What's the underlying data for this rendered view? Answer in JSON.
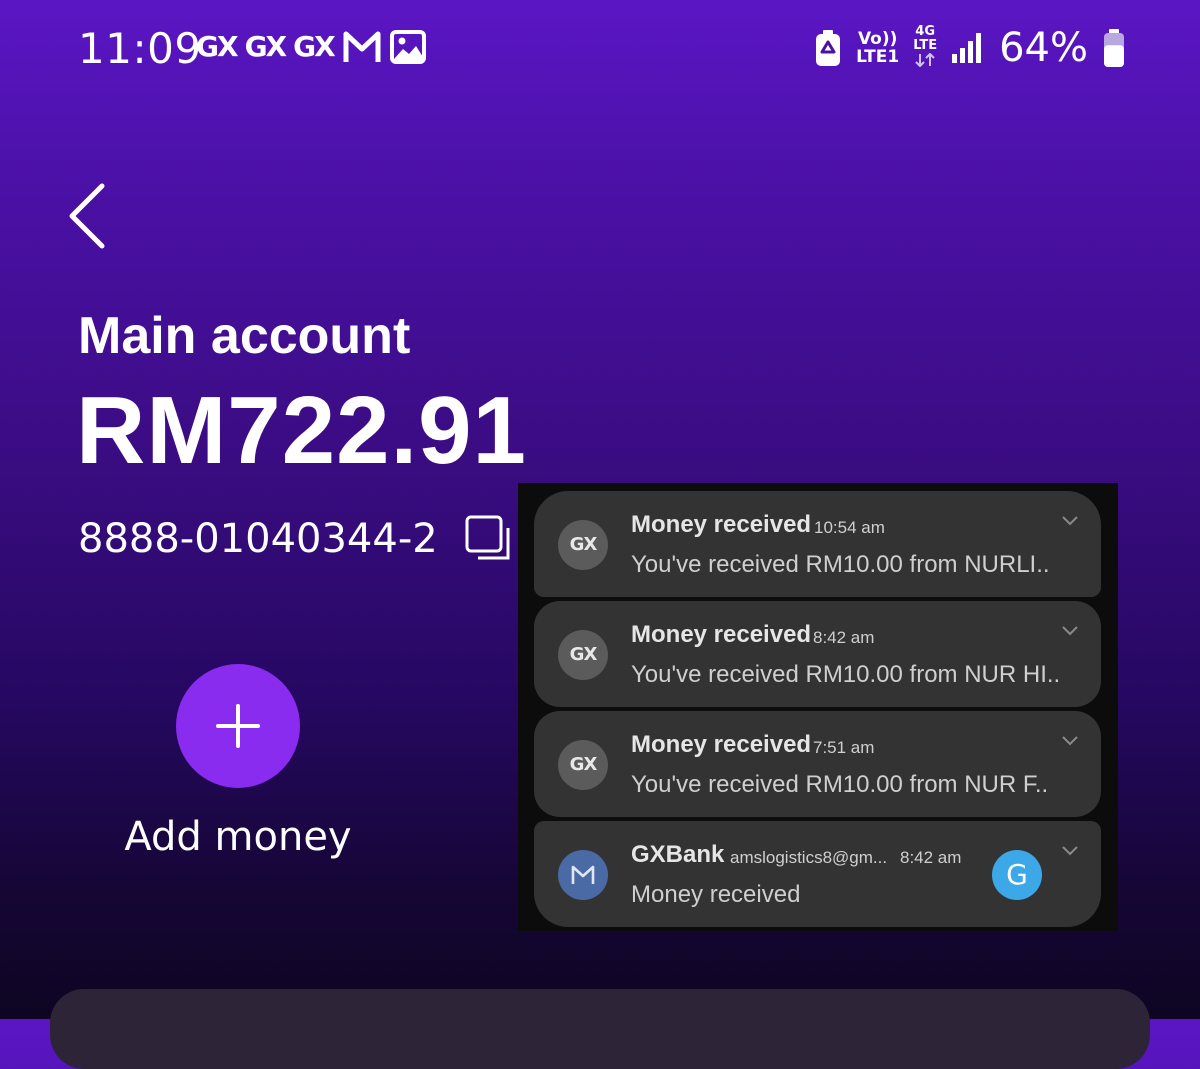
{
  "status_bar": {
    "time": "11:09",
    "app_icons": [
      "GX",
      "GX",
      "GX"
    ],
    "volte": [
      "Vo))",
      "LTE1"
    ],
    "network": "4G",
    "network_sub": "LTE",
    "battery_percent": "64%",
    "battery_level": 0.64
  },
  "account": {
    "title": "Main account",
    "balance": "RM722.91",
    "number": "8888-01040344-2"
  },
  "actions": {
    "add_money_label": "Add money"
  },
  "notifications": [
    {
      "app": "GX",
      "title": "Money received",
      "time": "10:54 am",
      "body": "You've received RM10.00 from NURLI.."
    },
    {
      "app": "GX",
      "title": "Money received",
      "time": "8:42 am",
      "body": "You've received RM10.00 from NUR HI.."
    },
    {
      "app": "GX",
      "title": "Money received",
      "time": "7:51 am",
      "body": "You've received RM10.00 from NUR F.."
    },
    {
      "app": "gmail-icon",
      "title": "GXBank",
      "subtitle": "amslogistics8@gm...",
      "time": "8:42 am",
      "body": "Money received",
      "avatar_letter": "G",
      "avatar_color": "#3ca8e8"
    }
  ],
  "colors": {
    "accent": "#8a2bf0",
    "background_top": "#5a16c4",
    "background_bottom": "#0e0522",
    "card": "#333333"
  }
}
